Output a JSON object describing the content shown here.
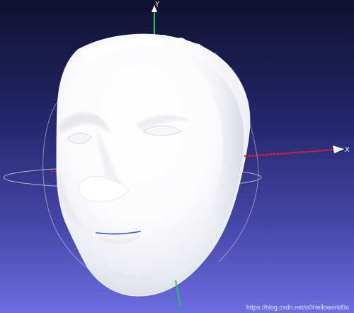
{
  "axis_labels": {
    "x": "X",
    "y": "Y"
  },
  "watermark": "https://blog.csdn.net/o0Helloworld0o",
  "colors": {
    "background_top": "#10112f",
    "background_bottom": "#6d6ee1",
    "mesh": "#ffffff",
    "x_axis": "#e11d35",
    "y_axis": "#22c55e",
    "trackball": "#d9dbe7",
    "mouth_line": "#4d5dd8"
  },
  "icons": {
    "mesh": "3d-face-mesh-icon",
    "trackball": "trackball-gizmo-icon"
  }
}
